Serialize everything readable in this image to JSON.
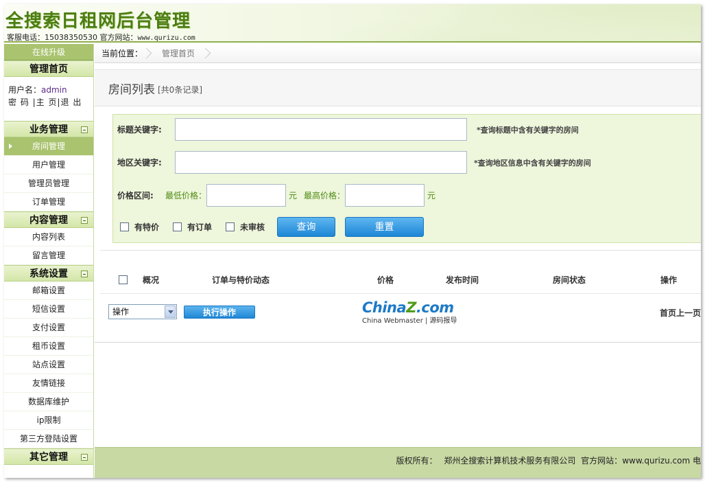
{
  "header": {
    "title": "全搜索日租网后台管理",
    "contact_prefix": "客服电话：15038350530 官方网站：",
    "contact_url": "www.qurizu.com"
  },
  "sidebar": {
    "upgrade": "在线升级",
    "home_section": "管理首页",
    "user_label": "用户名：",
    "username": "admin",
    "user_links": "密 码 |主 页|退 出",
    "sections": [
      {
        "title": "业务管理",
        "items": [
          "房间管理",
          "用户管理",
          "管理员管理",
          "订单管理"
        ]
      },
      {
        "title": "内容管理",
        "items": [
          "内容列表",
          "留言管理"
        ]
      },
      {
        "title": "系统设置",
        "items": [
          "邮箱设置",
          "短信设置",
          "支付设置",
          "租币设置",
          "站点设置",
          "友情链接",
          "数据库维护",
          "ip限制",
          "第三方登陆设置"
        ]
      },
      {
        "title": "其它管理",
        "items": []
      }
    ],
    "active_item": "房间管理"
  },
  "breadcrumb": {
    "label": "当前位置：",
    "current": "管理首页"
  },
  "page": {
    "title": "房间列表",
    "count": "[共0条记录]"
  },
  "search": {
    "title_keyword_label": "标题关键字:",
    "title_keyword_value": "",
    "title_keyword_hint": "*查询标题中含有关键字的房间",
    "area_keyword_label": "地区关键字:",
    "area_keyword_value": "",
    "area_keyword_hint": "*查询地区信息中含有关键字的房间",
    "price_label": "价格区间:",
    "min_price_label": "最低价格：",
    "min_price_value": "",
    "yuan": "元",
    "max_price_label": "最高价格：",
    "max_price_value": "",
    "checkbox_special": "有特价",
    "checkbox_order": "有订单",
    "checkbox_unreviewed": "未审核",
    "query_button": "查询",
    "reset_button": "重置"
  },
  "table": {
    "columns": [
      "概况",
      "订单与特价动态",
      "价格",
      "发布时间",
      "房间状态",
      "操作"
    ],
    "rows": []
  },
  "actions": {
    "select_value": "操作",
    "execute_button": "执行操作",
    "pager": "首页上一页"
  },
  "watermark": {
    "brand_main": "China",
    "brand_z": "Z",
    "brand_end": ".com",
    "tagline": "China Webmaster | 源码报导"
  },
  "footer": {
    "copyright_label": "版权所有：",
    "company": "郑州全搜索计算机技术服务有限公司",
    "site_label": "官方网站：",
    "site_url": "www.qurizu.com 电"
  }
}
